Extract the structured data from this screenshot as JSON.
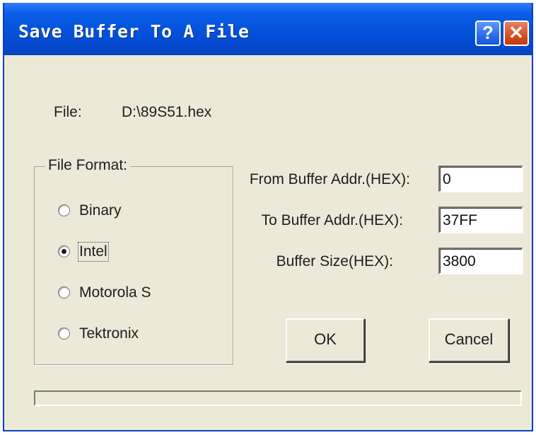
{
  "window": {
    "title": "Save Buffer To A File",
    "help_glyph": "?",
    "close_glyph": "✕"
  },
  "file": {
    "label": "File:",
    "path": "D:\\89S51.hex"
  },
  "format": {
    "group_label": "File Format:",
    "options": [
      {
        "label": "Binary",
        "selected": false
      },
      {
        "label": "Intel",
        "selected": true
      },
      {
        "label": "Motorola S",
        "selected": false
      },
      {
        "label": "Tektronix",
        "selected": false
      }
    ]
  },
  "fields": {
    "from_label": "From Buffer Addr.(HEX):",
    "from_value": "0",
    "to_label": "To Buffer Addr.(HEX):",
    "to_value": "37FF",
    "size_label": "Buffer Size(HEX):",
    "size_value": "3800"
  },
  "buttons": {
    "ok": "OK",
    "cancel": "Cancel"
  },
  "progress": {
    "fraction": 0
  },
  "colors": {
    "titlebar": "#0553dc",
    "dialog_bg": "#ece9d8",
    "close_button": "#d84d22"
  },
  "icons": {
    "help": "help-icon",
    "close": "close-icon"
  }
}
